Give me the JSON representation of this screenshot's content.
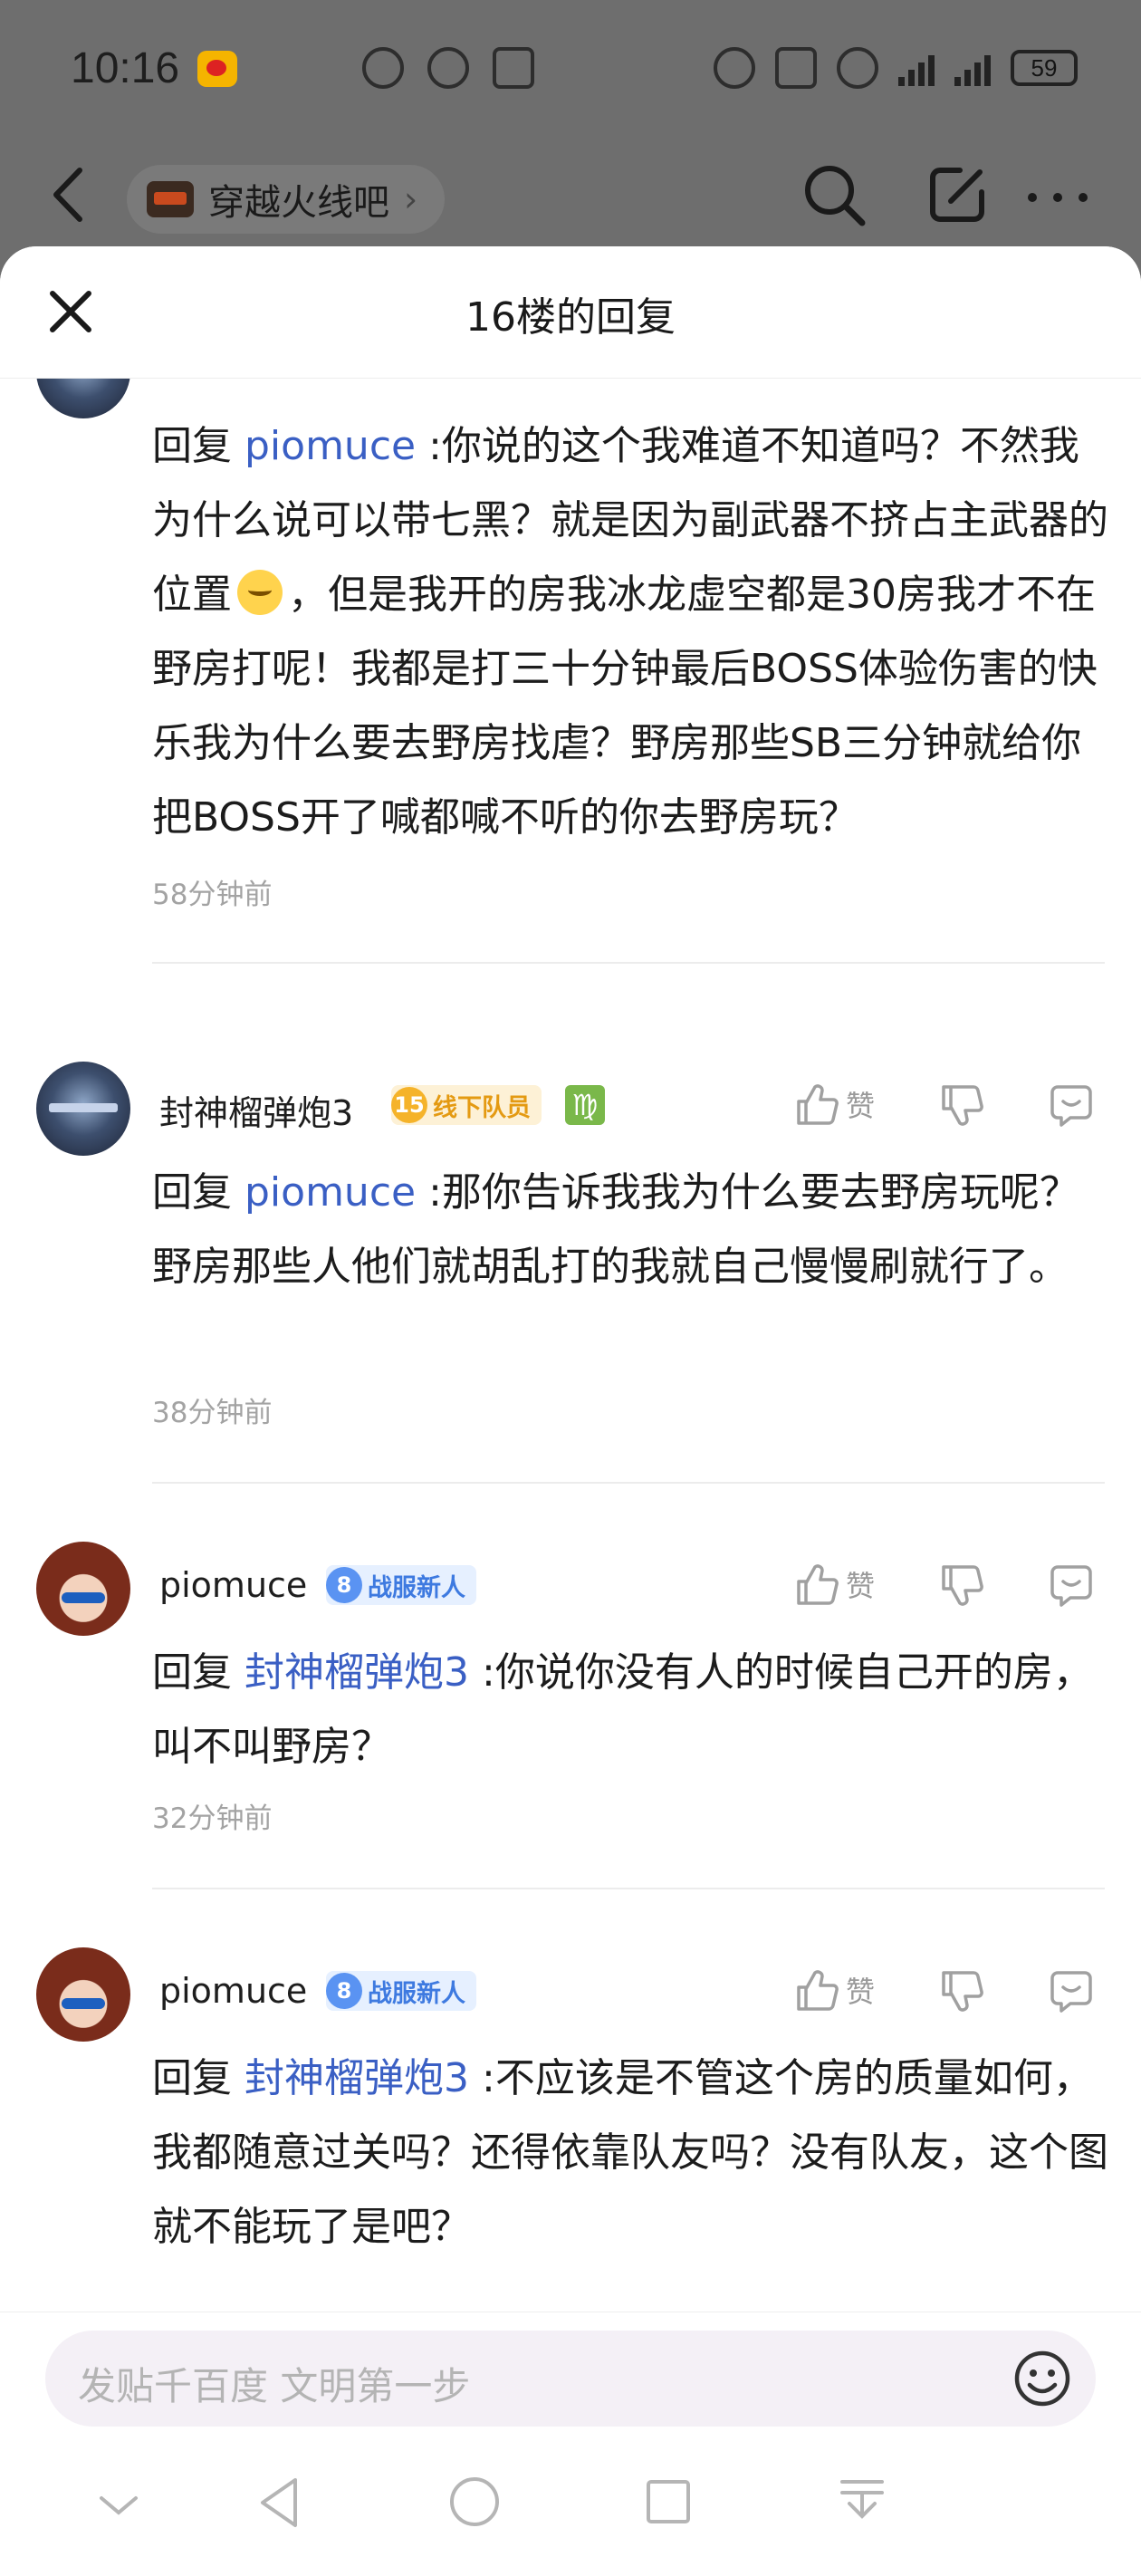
{
  "status_bar": {
    "time": "10:16",
    "battery": "59"
  },
  "top_nav": {
    "forum_name": "穿越火线吧"
  },
  "sheet": {
    "title": "16楼的回复"
  },
  "replies": [
    {
      "username": "",
      "reply_prefix": "回复",
      "mention": "piomuce",
      "text_a": ":你说的这个我难道不知道吗？不然我为什么说可以带七黑？就是因为副武器不挤占主武器的位置",
      "text_b": "，但是我开的房我冰龙虚空都是30房我才不在野房打呢！我都是打三十分钟最后BOSS体验伤害的快乐我为什么要去野房找虐？野房那些SB三分钟就给你把BOSS开了喊都喊不听的你去野房玩？",
      "time": "58分钟前"
    },
    {
      "username": "封神榴弹炮3",
      "badge_level": "15",
      "badge_label": "线下队员",
      "zodiac": "♍",
      "like_label": "赞",
      "reply_prefix": "回复",
      "mention": "piomuce",
      "text": ":那你告诉我我为什么要去野房玩呢？野房那些人他们就胡乱打的我就自己慢慢刷就行了。",
      "time": "38分钟前"
    },
    {
      "username": "piomuce",
      "badge_level": "8",
      "badge_label": "战服新人",
      "like_label": "赞",
      "reply_prefix": "回复",
      "mention": "封神榴弹炮3",
      "text": ":你说你没有人的时候自己开的房，叫不叫野房？",
      "time": "32分钟前"
    },
    {
      "username": "piomuce",
      "badge_level": "8",
      "badge_label": "战服新人",
      "like_label": "赞",
      "reply_prefix": "回复",
      "mention": "封神榴弹炮3",
      "text": ":不应该是不管这个房的质量如何，我都随意过关吗？还得依靠队友吗？没有队友，这个图就不能玩了是吧？"
    }
  ],
  "composer": {
    "placeholder": "发贴千百度 文明第一步"
  },
  "icons": {
    "back": "back-arrow-icon",
    "search": "search-icon",
    "edit": "edit-icon",
    "more": "more-icon",
    "close": "close-icon",
    "like": "thumbs-up-icon",
    "dislike": "thumbs-down-icon",
    "reply": "comment-icon",
    "emoji": "emoji-icon"
  },
  "colors": {
    "mention": "#3a5fc4",
    "badge_gold": "#e49a12",
    "badge_blue": "#3e7ae0"
  }
}
